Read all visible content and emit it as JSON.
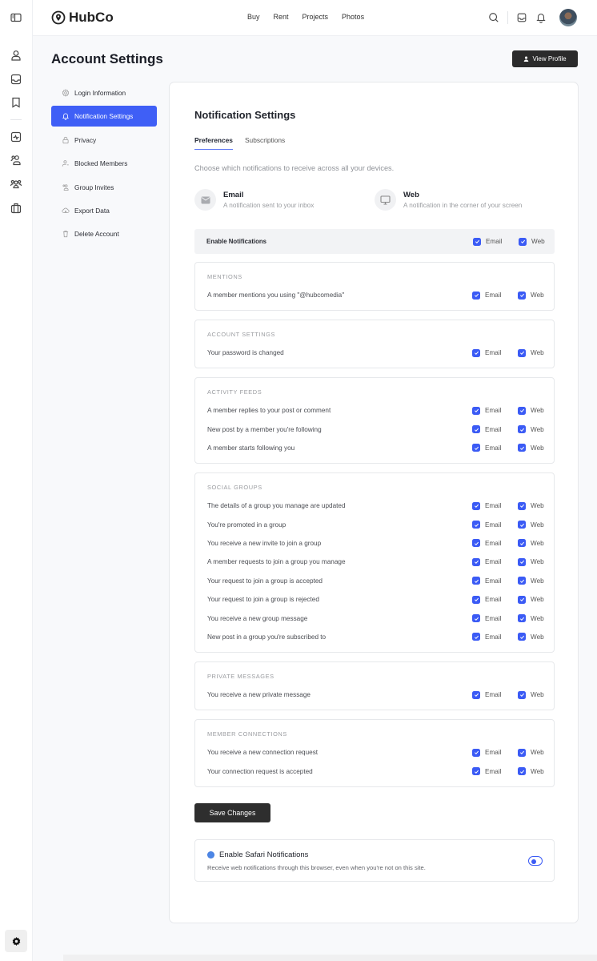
{
  "app": {
    "name": "HubCo"
  },
  "rail": {
    "icons": [
      "panel-toggle-icon",
      "profile-icon",
      "inbox-icon",
      "bookmark-icon",
      "activity-icon",
      "members-icon",
      "groups-icon",
      "briefcase-icon"
    ],
    "bottom_icon": "gear-icon"
  },
  "topnav": {
    "links": [
      "Buy",
      "Rent",
      "Projects",
      "Photos"
    ],
    "icons": [
      "search-icon",
      "inbox-icon",
      "bell-icon"
    ]
  },
  "page": {
    "title": "Account Settings",
    "view_profile_label": "View Profile"
  },
  "sidenav": {
    "items": [
      {
        "label": "Login Information",
        "icon": "gear-icon",
        "active": false
      },
      {
        "label": "Notification Settings",
        "icon": "bell-icon",
        "active": true
      },
      {
        "label": "Privacy",
        "icon": "lock-icon",
        "active": false
      },
      {
        "label": "Blocked Members",
        "icon": "blocked-user-icon",
        "active": false
      },
      {
        "label": "Group Invites",
        "icon": "group-invite-icon",
        "active": false
      },
      {
        "label": "Export Data",
        "icon": "cloud-download-icon",
        "active": false
      },
      {
        "label": "Delete Account",
        "icon": "trash-icon",
        "active": false
      }
    ]
  },
  "main": {
    "title": "Notification Settings",
    "tabs": [
      {
        "label": "Preferences",
        "active": true
      },
      {
        "label": "Subscriptions",
        "active": false
      }
    ],
    "lead": "Choose which notifications to receive across all your devices.",
    "channels": [
      {
        "title": "Email",
        "desc": "A notification sent to your inbox",
        "icon": "envelope-icon"
      },
      {
        "title": "Web",
        "desc": "A notification in the corner of your screen",
        "icon": "monitor-icon"
      }
    ],
    "enable": {
      "label": "Enable Notifications",
      "email_label": "Email",
      "web_label": "Web",
      "email": true,
      "web": true
    },
    "option_labels": {
      "email": "Email",
      "web": "Web"
    },
    "groups": [
      {
        "title": "MENTIONS",
        "rows": [
          {
            "label": "A member mentions you using \"@hubcomedia\"",
            "email": true,
            "web": true
          }
        ]
      },
      {
        "title": "ACCOUNT SETTINGS",
        "rows": [
          {
            "label": "Your password is changed",
            "email": true,
            "web": true
          }
        ]
      },
      {
        "title": "ACTIVITY FEEDS",
        "rows": [
          {
            "label": "A member replies to your post or comment",
            "email": true,
            "web": true
          },
          {
            "label": "New post by a member you're following",
            "email": true,
            "web": true
          },
          {
            "label": "A member starts following you",
            "email": true,
            "web": true
          }
        ]
      },
      {
        "title": "SOCIAL GROUPS",
        "rows": [
          {
            "label": "The details of a group you manage are updated",
            "email": true,
            "web": true
          },
          {
            "label": "You're promoted in a group",
            "email": true,
            "web": true
          },
          {
            "label": "You receive a new invite to join a group",
            "email": true,
            "web": true
          },
          {
            "label": "A member requests to join a group you manage",
            "email": true,
            "web": true
          },
          {
            "label": "Your request to join a group is accepted",
            "email": true,
            "web": true
          },
          {
            "label": "Your request to join a group is rejected",
            "email": true,
            "web": true
          },
          {
            "label": "You receive a new group message",
            "email": true,
            "web": true
          },
          {
            "label": "New post in a group you're subscribed to",
            "email": true,
            "web": true
          }
        ]
      },
      {
        "title": "PRIVATE MESSAGES",
        "rows": [
          {
            "label": "You receive a new private message",
            "email": true,
            "web": true
          }
        ]
      },
      {
        "title": "MEMBER CONNECTIONS",
        "rows": [
          {
            "label": "You receive a new connection request",
            "email": true,
            "web": true
          },
          {
            "label": "Your connection request is accepted",
            "email": true,
            "web": true
          }
        ]
      }
    ],
    "save_label": "Save Changes",
    "safari": {
      "title": "Enable Safari Notifications",
      "desc": "Receive web notifications through this browser, even when you're not on this site.",
      "enabled": true
    }
  },
  "colors": {
    "accent": "#3f5ff6",
    "dark_button": "#2b2b2b"
  }
}
